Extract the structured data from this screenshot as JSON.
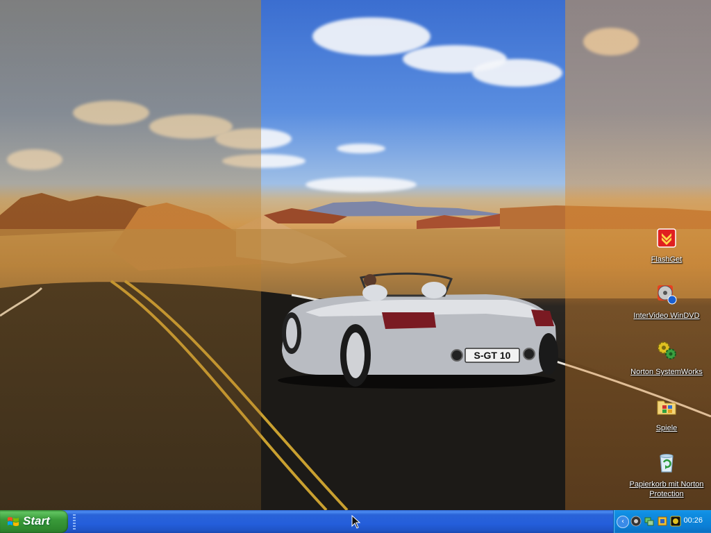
{
  "desktop": {
    "icons": [
      {
        "label": "FlashGet",
        "icon": "flashget-icon"
      },
      {
        "label": "InterVideo WinDVD",
        "icon": "windvd-icon"
      },
      {
        "label": "Norton SystemWorks",
        "icon": "norton-systemworks-icon"
      },
      {
        "label": "Spiele",
        "icon": "folder-games-icon"
      },
      {
        "label": "Papierkorb mit Norton Protection",
        "icon": "recycle-bin-icon"
      }
    ],
    "wallpaper": "desert road with silver roadster"
  },
  "wallpaper_plate": "S-GT 10",
  "taskbar": {
    "start_label": "Start",
    "clock": "00:26"
  },
  "colors": {
    "taskbar_blue": "#245edb",
    "start_green": "#3a9b3a",
    "tray_blue": "#0b7fd6"
  }
}
